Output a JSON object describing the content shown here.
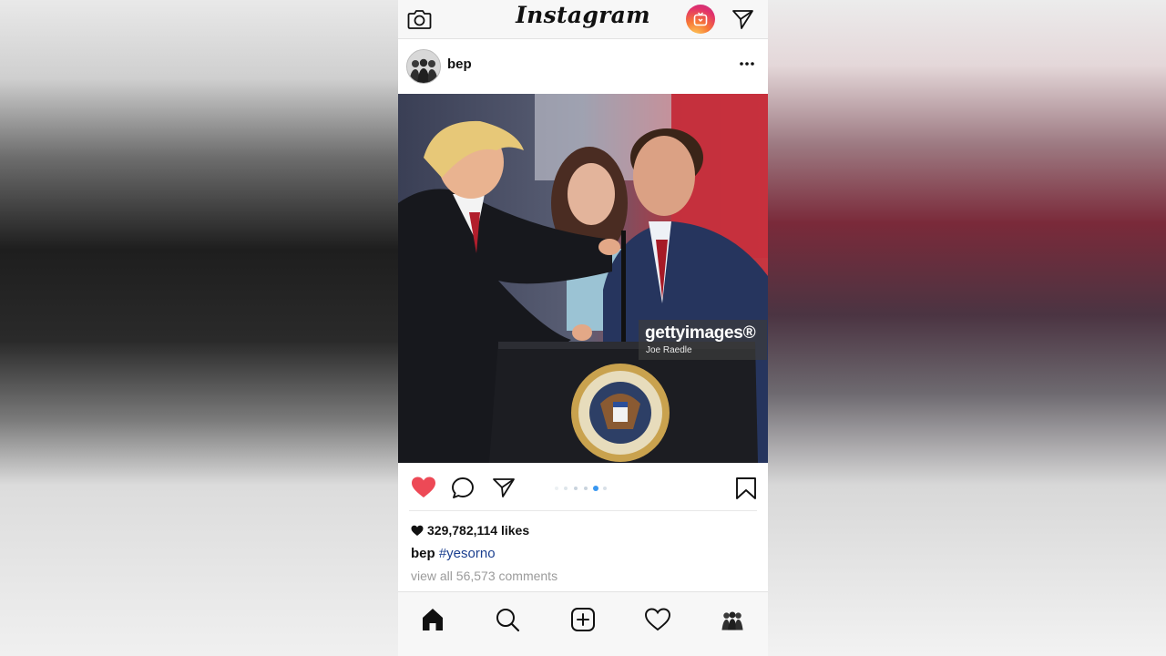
{
  "app": {
    "name": "Instagram"
  },
  "icons": {
    "camera": "camera-icon",
    "igtv": "igtv-icon",
    "direct": "paper-plane-icon",
    "more": "more-dots-icon",
    "like": "heart-filled-icon",
    "comment": "comment-icon",
    "share": "paper-plane-icon",
    "save": "bookmark-icon",
    "home": "home-icon",
    "search": "search-icon",
    "add": "add-post-icon",
    "activity": "heart-outline-icon",
    "profile": "profile-avatar-icon"
  },
  "colors": {
    "like": "#ed4956",
    "hashtag": "#1b3f8f",
    "dot_active": "#3897f0",
    "muted": "#9b9b9b"
  },
  "post": {
    "username": "bep",
    "watermark": {
      "brand": "gettyimages®",
      "credit": "Joe Raedle"
    },
    "carousel": {
      "count": 6,
      "active_index": 4
    },
    "likes": "329,782,114 likes",
    "caption": {
      "username": "bep",
      "hashtag": "#yesorno"
    },
    "comments_link": "view all 56,573 comments"
  }
}
